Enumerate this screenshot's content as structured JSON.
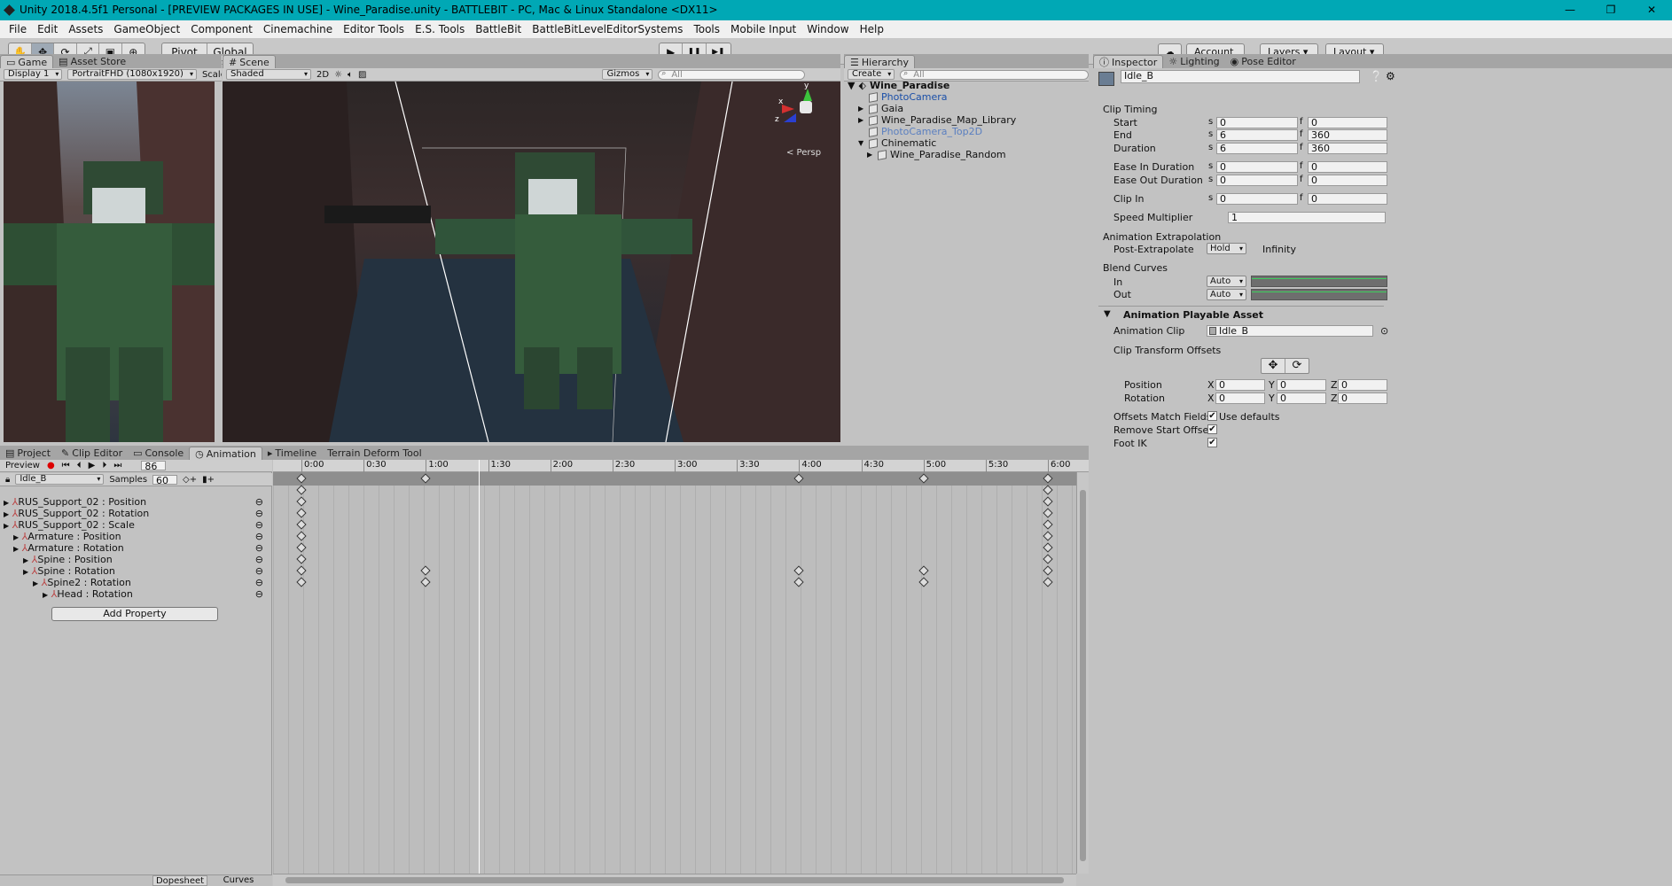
{
  "window": {
    "title": "Unity 2018.4.5f1 Personal - [PREVIEW PACKAGES IN USE] - Wine_Paradise.unity - BATTLEBIT - PC, Mac & Linux Standalone <DX11>",
    "minimize": "—",
    "maximize": "❐",
    "close": "✕"
  },
  "menu": [
    "File",
    "Edit",
    "Assets",
    "GameObject",
    "Component",
    "Cinemachine",
    "Editor Tools",
    "E.S. Tools",
    "BattleBit",
    "BattleBitLevelEditorSystems",
    "Tools",
    "Mobile Input",
    "Window",
    "Help"
  ],
  "toolbar": {
    "tools": [
      "✋",
      "✥",
      "⟳",
      "⤢",
      "▣",
      "⊕"
    ],
    "pivot": "Pivot",
    "global": "Global",
    "play": "▶",
    "pause": "❚❚",
    "step": "▶❚",
    "account": "Account",
    "layers": "Layers",
    "layout": "Layout"
  },
  "game": {
    "tabs": [
      "Game",
      "Asset Store"
    ],
    "display": "Display 1",
    "resolution": "PortraitFHD (1080x1920)",
    "scale": "Scale"
  },
  "scene": {
    "tab": "Scene",
    "shaded": "Shaded",
    "mode2d": "2D",
    "gizmos": "Gizmos",
    "search": "All",
    "persp": "< Persp",
    "axis_x": "x",
    "axis_y": "y",
    "axis_z": "z"
  },
  "hierarchy": {
    "tab": "Hierarchy",
    "create": "Create",
    "search": "All",
    "scene_name": "Wine_Paradise",
    "items": [
      {
        "label": "PhotoCamera",
        "color": "#1a4fa8",
        "indent": 1,
        "arrow": ""
      },
      {
        "label": "Gaia",
        "color": "#111111",
        "indent": 1,
        "arrow": "▶"
      },
      {
        "label": "Wine_Paradise_Map_Library",
        "color": "#111111",
        "indent": 1,
        "arrow": "▶"
      },
      {
        "label": "PhotoCamera_Top2D",
        "color": "#5a7fc0",
        "indent": 1,
        "arrow": ""
      },
      {
        "label": "Chinematic",
        "color": "#111111",
        "indent": 1,
        "arrow": "▼"
      },
      {
        "label": "Wine_Paradise_Random",
        "color": "#111111",
        "indent": 2,
        "arrow": "▶"
      }
    ]
  },
  "inspector": {
    "tabs": [
      "Inspector",
      "Lighting",
      "Pose Editor"
    ],
    "object_name": "Idle_B",
    "clip_timing": "Clip Timing",
    "rows": [
      {
        "label": "Start",
        "s": "0",
        "f": "0"
      },
      {
        "label": "End",
        "s": "6",
        "f": "360"
      },
      {
        "label": "Duration",
        "s": "6",
        "f": "360"
      },
      {
        "label": "Ease In Duration",
        "s": "0",
        "f": "0"
      },
      {
        "label": "Ease Out Duration",
        "s": "0",
        "f": "0"
      },
      {
        "label": "Clip In",
        "s": "0",
        "f": "0"
      }
    ],
    "s": "s",
    "f": "f",
    "speed_label": "Speed Multiplier",
    "speed_value": "1",
    "extrap_header": "Animation Extrapolation",
    "post_extrap_label": "Post-Extrapolate",
    "post_extrap_value": "Hold",
    "infinity": "Infinity",
    "blend_header": "Blend Curves",
    "blend_in": "In",
    "blend_out": "Out",
    "auto": "Auto",
    "playable_header": "Animation Playable Asset",
    "anim_clip_label": "Animation Clip",
    "anim_clip_value": "Idle_B",
    "offsets_label": "Clip Transform Offsets",
    "position_label": "Position",
    "rotation_label": "Rotation",
    "x": "X",
    "y": "Y",
    "z": "Z",
    "zero": "0",
    "match_fields": "Offsets Match Fields",
    "use_defaults": "Use defaults",
    "remove_start": "Remove Start Offset",
    "foot_ik": "Foot IK",
    "checkmark": "✔"
  },
  "bottom_tabs": [
    "Project",
    "Clip Editor",
    "Console",
    "Animation",
    "Timeline",
    "Terrain Deform Tool"
  ],
  "animation": {
    "preview": "Preview",
    "frame": "86",
    "clip": "Idle_B",
    "samples_label": "Samples",
    "samples": "60",
    "properties": [
      {
        "label": "RUS_Support_02 : Position",
        "indent": 0
      },
      {
        "label": "RUS_Support_02 : Rotation",
        "indent": 0
      },
      {
        "label": "RUS_Support_02 : Scale",
        "indent": 0
      },
      {
        "label": "Armature : Position",
        "indent": 1
      },
      {
        "label": "Armature : Rotation",
        "indent": 1
      },
      {
        "label": "Spine : Position",
        "indent": 2
      },
      {
        "label": "Spine : Rotation",
        "indent": 2
      },
      {
        "label": "Spine2 : Rotation",
        "indent": 3
      },
      {
        "label": "Head : Rotation",
        "indent": 4
      }
    ],
    "add_property": "Add Property",
    "dopesheet": "Dopesheet",
    "curves": "Curves",
    "ticks": [
      "0:00",
      "0:30",
      "1:00",
      "1:30",
      "2:00",
      "2:30",
      "3:00",
      "3:30",
      "4:00",
      "4:30",
      "5:00",
      "5:30",
      "6:00"
    ]
  }
}
